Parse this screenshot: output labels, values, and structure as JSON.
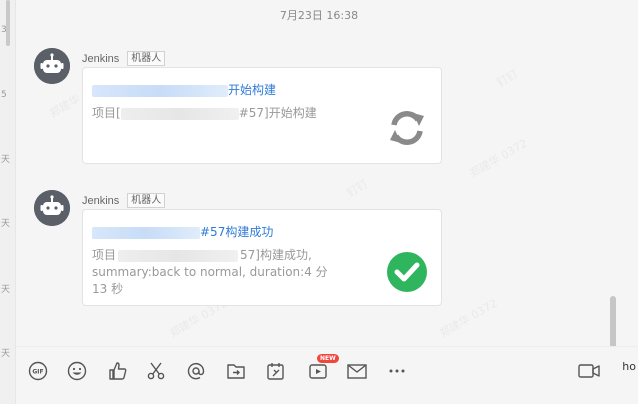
{
  "timestamp": "7月23日 16:38",
  "messages": [
    {
      "sender": "Jenkins",
      "badge": "机器人",
      "title_suffix": "开始构建",
      "body_prefix": "项目[",
      "body_suffix": "#57]开始构建",
      "status_icon": "refresh-icon"
    },
    {
      "sender": "Jenkins",
      "badge": "机器人",
      "title_suffix": "#57构建成功",
      "body_prefix": "项目",
      "body_mid": "57]构建成功,",
      "body_line2": "summary:back to normal, duration:4 分",
      "body_line3": "13 秒",
      "status_icon": "success-check-icon"
    }
  ],
  "watermarks": [
    "郑建华 0372",
    "钉钉"
  ],
  "toolbar": {
    "icons": [
      "gif-icon",
      "emoji-icon",
      "thumbs-up-icon",
      "scissors-icon",
      "at-icon",
      "folder-share-icon",
      "pin-icon",
      "video-message-icon",
      "mail-icon",
      "more-icon",
      "video-call-icon"
    ],
    "new_badge": "NEW"
  },
  "side_text": "ho",
  "left_strip_chars": [
    "3",
    "5",
    "天",
    "天",
    "天",
    "天"
  ],
  "colors": {
    "link": "#2f7bd8",
    "success": "#2fb55d",
    "refresh": "#8a8a8a"
  }
}
